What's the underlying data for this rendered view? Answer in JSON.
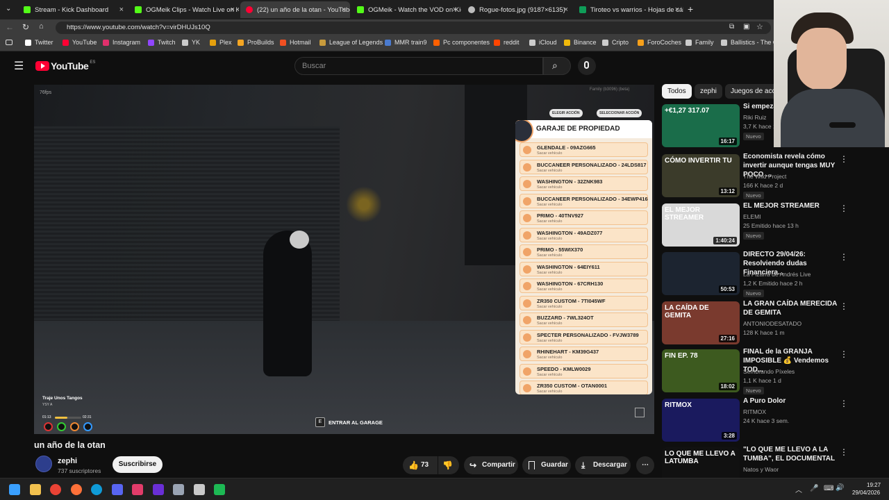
{
  "browser": {
    "tabs": [
      {
        "title": "Stream - Kick Dashboard",
        "color": "#53fc18",
        "active": false
      },
      {
        "title": "OGMeik Clips - Watch Live on Kick",
        "color": "#53fc18",
        "active": false
      },
      {
        "title": "(22) un año de la otan - YouTube",
        "color": "#ff0033",
        "active": true
      },
      {
        "title": "OGMeik - Watch the VOD on Kick",
        "color": "#53fc18",
        "active": false
      },
      {
        "title": "Rogue-fotos.jpg (9187×6135)",
        "color": "#bdbdbd",
        "active": false
      },
      {
        "title": "Tiroteo vs warrios - Hojas de cálcu",
        "color": "#0f9d58",
        "active": false
      }
    ],
    "url": "https://www.youtube.com/watch?v=virDHUJs10Q",
    "bookmarks": [
      {
        "label": "Twitter",
        "color": "#ffffff"
      },
      {
        "label": "YouTube",
        "color": "#ff0033"
      },
      {
        "label": "Instagram",
        "color": "#e1306c"
      },
      {
        "label": "Twitch",
        "color": "#9146ff"
      },
      {
        "label": "YK",
        "color": "#cccccc"
      },
      {
        "label": "Plex",
        "color": "#e5a00d"
      },
      {
        "label": "ProBuilds",
        "color": "#f5a623"
      },
      {
        "label": "Hotmail",
        "color": "#f25022"
      },
      {
        "label": "League of Legends",
        "color": "#c89b3c"
      },
      {
        "label": "MMR train9",
        "color": "#4a7bd0"
      },
      {
        "label": "Pc componentes",
        "color": "#ff6000"
      },
      {
        "label": "reddit",
        "color": "#ff4500"
      },
      {
        "label": "iCloud",
        "color": "#cccccc"
      },
      {
        "label": "Binance",
        "color": "#f0b90b"
      },
      {
        "label": "Cripto",
        "color": "#cccccc"
      },
      {
        "label": "ForoCoches",
        "color": "#f6a01a"
      },
      {
        "label": "Family",
        "color": "#cccccc"
      },
      {
        "label": "Ballistics - The Of",
        "color": "#cccccc"
      }
    ]
  },
  "youtube": {
    "logo": "YouTube",
    "region": "ES",
    "search_placeholder": "Buscar",
    "video": {
      "title": "un año de la otan",
      "fps": "76fps",
      "game_hud": {
        "top_right": "Family (b3096) (beta)",
        "btn_elegir": "ELEGIR ACCIÓN",
        "btn_seleccionar": "SELECCIONAR ACCIÓN",
        "garage_title": "GARAJE DE PROPIEDAD",
        "sub_label": "Sacar vehículo",
        "vehicles": [
          "GLENDALE - 09AZG665",
          "BUCCANEER PERSONALIZADO - 24LDS817",
          "WASHINGTON - 32ZNK983",
          "BUCCANEER PERSONALIZADO - 34EWP416",
          "PRIMO - 40TNV927",
          "WASHINGTON - 49ADZ077",
          "PRIMO - 55WIX370",
          "WASHINGTON - 64EIY611",
          "WASHINGTON - 67CRH130",
          "ZR350 CUSTOM - 7TI045WF",
          "BUZZARD - 7WL324OT",
          "SPECTER PERSONALIZADO - FVJW3789",
          "RHINEHART - KM39G437",
          "SPEEDO - KMLW0029",
          "ZR350 CUSTOM - OTAN0001"
        ],
        "song": "Traje Unos Tangos",
        "artist": "YSY A",
        "time_current": "01:13",
        "time_total": "02:31",
        "prompt_key": "E",
        "prompt_text": "ENTRAR AL GARAGE"
      }
    },
    "channel": {
      "name": "zephi",
      "subs": "737 suscriptores",
      "subscribe": "Suscribirse"
    },
    "actions": {
      "likes": "73",
      "share": "Compartir",
      "save": "Guardar",
      "download": "Descargar"
    },
    "chips": [
      "Todos",
      "zephi",
      "Juegos de acci"
    ],
    "recommendations": [
      {
        "title": "Si empeza Esto es Lo",
        "channel": "Riki Ruiz",
        "meta": "3,7 K hace 1 h",
        "badge": "Nuevo",
        "duration": "16:17",
        "thumb_text": "+€1,27 317.07",
        "thumb_color": "#1a6d4a"
      },
      {
        "title": "Economista revela cómo invertir aunque tengas MUY POCO ...",
        "channel": "The Wild Project",
        "meta": "166 K hace 2 d",
        "badge": "Nuevo",
        "duration": "13:12",
        "thumb_text": "CÓMO INVERTIR TU",
        "thumb_color": "#3b3b2a"
      },
      {
        "title": "EL MEJOR STREAMER",
        "channel": "ELEMI",
        "meta": "25 Emitido hace 13 h",
        "badge": "Nuevo",
        "duration": "1:40:24",
        "thumb_text": "EL MEJOR STREAMER",
        "thumb_color": "#d9d9d9"
      },
      {
        "title": "DIRECTO 29/04/26: Resolviendo dudas Financiera...",
        "channel": "La Pizarra de Andrés Live",
        "meta": "1,2 K Emitido hace 2 h",
        "badge": "Nuevo",
        "duration": "50:53",
        "thumb_text": "",
        "thumb_color": "#1c2430"
      },
      {
        "title": "LA GRAN CAÍDA MERECIDA DE GEMITA",
        "channel": "ANTONIODESATADO",
        "meta": "128 K hace 1 m",
        "badge": "",
        "duration": "27:16",
        "thumb_text": "LA CAÍDA DE GEMITA",
        "thumb_color": "#7a3a2e"
      },
      {
        "title": "FINAL de la GRANJA IMPOSIBLE 💰 Vendemos TOD...",
        "channel": "Sembrando Píxeles",
        "meta": "1,1 K hace 1 d",
        "badge": "Nuevo",
        "duration": "18:02",
        "thumb_text": "FIN EP. 78",
        "thumb_color": "#3d5a1f"
      },
      {
        "title": "A Puro Dolor",
        "channel": "RITMOX",
        "meta": "24 K hace 3 sem.",
        "badge": "",
        "duration": "3:28",
        "thumb_text": "RITMOX",
        "thumb_color": "#1a1a5e"
      },
      {
        "title": "\"LO QUE ME LLEVO A LA TUMBA\", EL DOCUMENTAL",
        "channel": "Natos y Waor",
        "meta": "",
        "badge": "",
        "duration": "",
        "thumb_text": "LO QUE ME LLEVO A LATUMBA",
        "thumb_color": "#111111"
      }
    ]
  },
  "taskbar": {
    "time": "19:27",
    "date": "29/04/2026",
    "apps": [
      {
        "name": "windows",
        "color": "#3aa0ff"
      },
      {
        "name": "explorer",
        "color": "#f2c14e"
      },
      {
        "name": "chrome",
        "color": "#ea4335"
      },
      {
        "name": "firefox",
        "color": "#ff7139"
      },
      {
        "name": "edge",
        "color": "#0f9bd7"
      },
      {
        "name": "discord",
        "color": "#5865f2"
      },
      {
        "name": "kick-app",
        "color": "#e23c6a"
      },
      {
        "name": "next",
        "color": "#6a2fd6"
      },
      {
        "name": "settings",
        "color": "#9aa4b3"
      },
      {
        "name": "steam-like",
        "color": "#c9c9c9"
      },
      {
        "name": "spotify",
        "color": "#1db954"
      }
    ]
  }
}
